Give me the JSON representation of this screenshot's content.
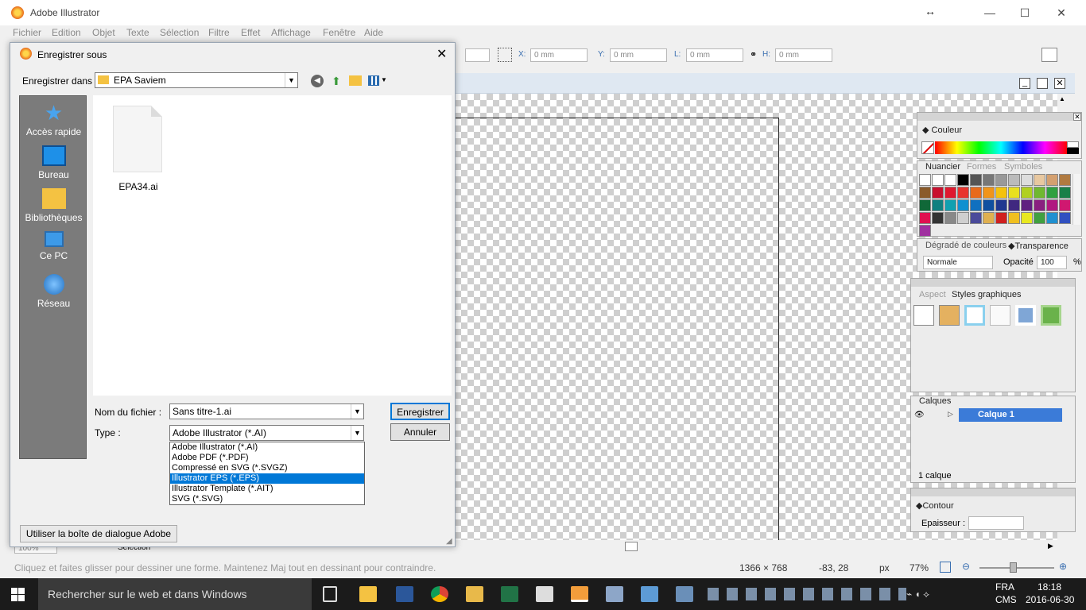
{
  "window": {
    "title": "Adobe Illustrator"
  },
  "menu": [
    "Fichier",
    "Edition",
    "Objet",
    "Texte",
    "Sélection",
    "Filtre",
    "Effet",
    "Affichage",
    "Fenêtre",
    "Aide"
  ],
  "toolbar": {
    "x_label": "X:",
    "x_value": "0 mm",
    "y_label": "Y:",
    "y_value": "0 mm",
    "l_label": "L:",
    "l_value": "0 mm",
    "h_label": "H:",
    "h_value": "0 mm"
  },
  "panels": {
    "color": {
      "tab": "Couleur"
    },
    "swatches": {
      "tabs": [
        "Nuancier",
        "Formes",
        "Symboles"
      ]
    },
    "gradient": {
      "tabs": [
        "Dégradé de couleurs",
        "Transparence"
      ],
      "mode": "Normale",
      "opacity_label": "Opacité",
      "opacity_value": "100",
      "opacity_unit": "%"
    },
    "appearance": {
      "tabs": [
        "Aspect",
        "Styles graphiques"
      ]
    },
    "layers": {
      "tab": "Calques",
      "layer_name": "Calque 1",
      "count": "1 calque"
    },
    "stroke": {
      "tab": "Contour",
      "weight_label": "Epaisseur :"
    }
  },
  "zoom_field": {
    "value": "100%",
    "tool": "Sélection"
  },
  "statusbar": {
    "hint": "Cliquez et faites glisser pour dessiner une forme. Maintenez Maj tout en dessinant pour contraindre.",
    "doc_size": "1366 × 768",
    "coords": "-83, 28",
    "unit": "px",
    "zoom": "77%"
  },
  "taskbar": {
    "search_placeholder": "Rechercher sur le web et dans Windows",
    "lang": "FRA",
    "layout": "CMS",
    "time": "18:18",
    "date": "2016-06-30"
  },
  "dialog": {
    "title": "Enregistrer sous",
    "save_in_label": "Enregistrer dans :",
    "save_in_value": "EPA Saviem",
    "places": [
      "Accès rapide",
      "Bureau",
      "Bibliothèques",
      "Ce PC",
      "Réseau"
    ],
    "files": [
      {
        "name": "EPA34.ai"
      }
    ],
    "filename_label": "Nom du fichier :",
    "filename_value": "Sans titre-1.ai",
    "type_label": "Type :",
    "type_value": "Adobe Illustrator (*.AI)",
    "type_options": [
      "Adobe Illustrator (*.AI)",
      "Adobe PDF (*.PDF)",
      "Compressé en SVG (*.SVGZ)",
      "Illustrator EPS (*.EPS)",
      "Illustrator Template (*.AIT)",
      "SVG (*.SVG)"
    ],
    "type_selected_index": 3,
    "save_button": "Enregistrer",
    "cancel_button": "Annuler",
    "adobe_dialog_button": "Utiliser la boîte de dialogue Adobe"
  },
  "colors": {
    "accent": "#0078d7",
    "taskbar": "#1b1b1b",
    "places_bg": "#7b7b7b",
    "layer_highlight": "#3b7bd8"
  }
}
